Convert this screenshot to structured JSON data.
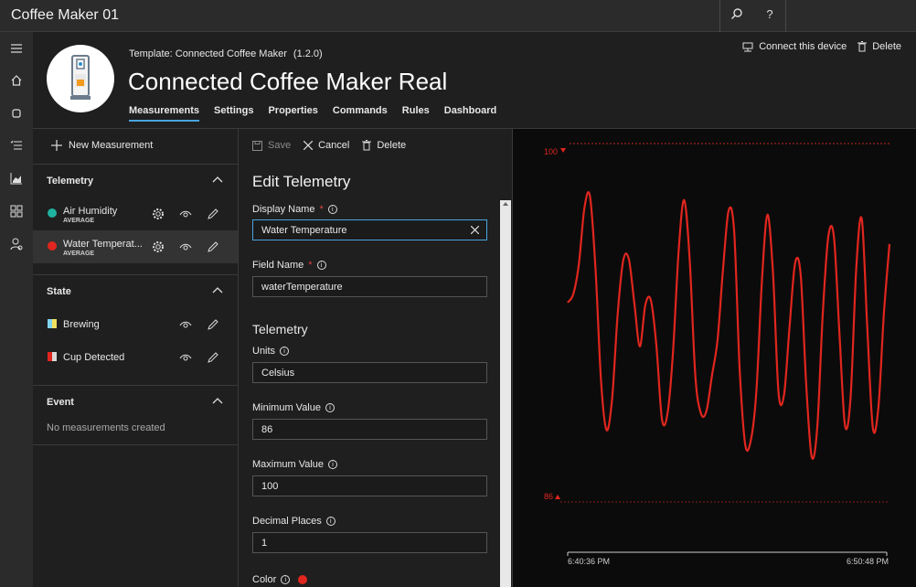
{
  "app": {
    "title": "Coffee Maker 01"
  },
  "header": {
    "template_label": "Template:",
    "template_name": "Connected Coffee Maker",
    "template_version": "(1.2.0)",
    "device_title": "Connected Coffee Maker Real",
    "tabs": [
      {
        "label": "Measurements",
        "active": true
      },
      {
        "label": "Settings"
      },
      {
        "label": "Properties"
      },
      {
        "label": "Commands"
      },
      {
        "label": "Rules"
      },
      {
        "label": "Dashboard"
      }
    ],
    "connect_label": "Connect this device",
    "delete_label": "Delete"
  },
  "measurements": {
    "new_label": "New Measurement",
    "telemetry": {
      "title": "Telemetry",
      "items": [
        {
          "name": "Air Humidity",
          "aggregate": "AVERAGE",
          "color": "#20b2a0"
        },
        {
          "name": "Water Temperat...",
          "aggregate": "AVERAGE",
          "color": "#e0261e",
          "selected": true
        }
      ]
    },
    "state": {
      "title": "State",
      "items": [
        {
          "name": "Brewing",
          "colors": [
            "#7fd3f0",
            "#f0e060"
          ]
        },
        {
          "name": "Cup Detected",
          "colors": [
            "#e0261e",
            "#d8d8d8"
          ]
        }
      ]
    },
    "event": {
      "title": "Event",
      "empty": "No measurements created"
    }
  },
  "edit": {
    "save_label": "Save",
    "cancel_label": "Cancel",
    "delete_label": "Delete",
    "title": "Edit Telemetry",
    "display_name_label": "Display Name",
    "display_name_value": "Water Temperature",
    "field_name_label": "Field Name",
    "field_name_value": "waterTemperature",
    "telemetry_heading": "Telemetry",
    "units_label": "Units",
    "units_value": "Celsius",
    "min_label": "Minimum Value",
    "min_value": "86",
    "max_label": "Maximum Value",
    "max_value": "100",
    "decimal_label": "Decimal Places",
    "decimal_value": "1",
    "color_label": "Color",
    "color": "#e0261e",
    "required_mark": "*"
  },
  "chart": {
    "max_label": "100",
    "min_label": "86",
    "x_start": "6:40:36 PM",
    "x_end": "6:50:48 PM",
    "line_color": "#e0261e",
    "samples": [
      94.1,
      94.5,
      95.9,
      98.6,
      99.2,
      95.8,
      90.4,
      88.0,
      89.5,
      93.5,
      96.1,
      96.2,
      94.1,
      92.0,
      94.0,
      94.2,
      92.0,
      88.5,
      88.8,
      91.8,
      96.6,
      99.0,
      96.1,
      90.6,
      88.8,
      88.9,
      90.6,
      92.3,
      95.7,
      98.5,
      97.5,
      90.9,
      87.3,
      87.5,
      89.8,
      95.1,
      98.3,
      95.5,
      89.8,
      89.7,
      93.0,
      96.0,
      95.4,
      90.1,
      86.7,
      88.2,
      93.7,
      97.3,
      97.2,
      92.5,
      88.2,
      89.6,
      95.7,
      98.1,
      92.9,
      88.1,
      89.1,
      93.6,
      96.9
    ],
    "ymin": 86,
    "ymax": 100
  }
}
